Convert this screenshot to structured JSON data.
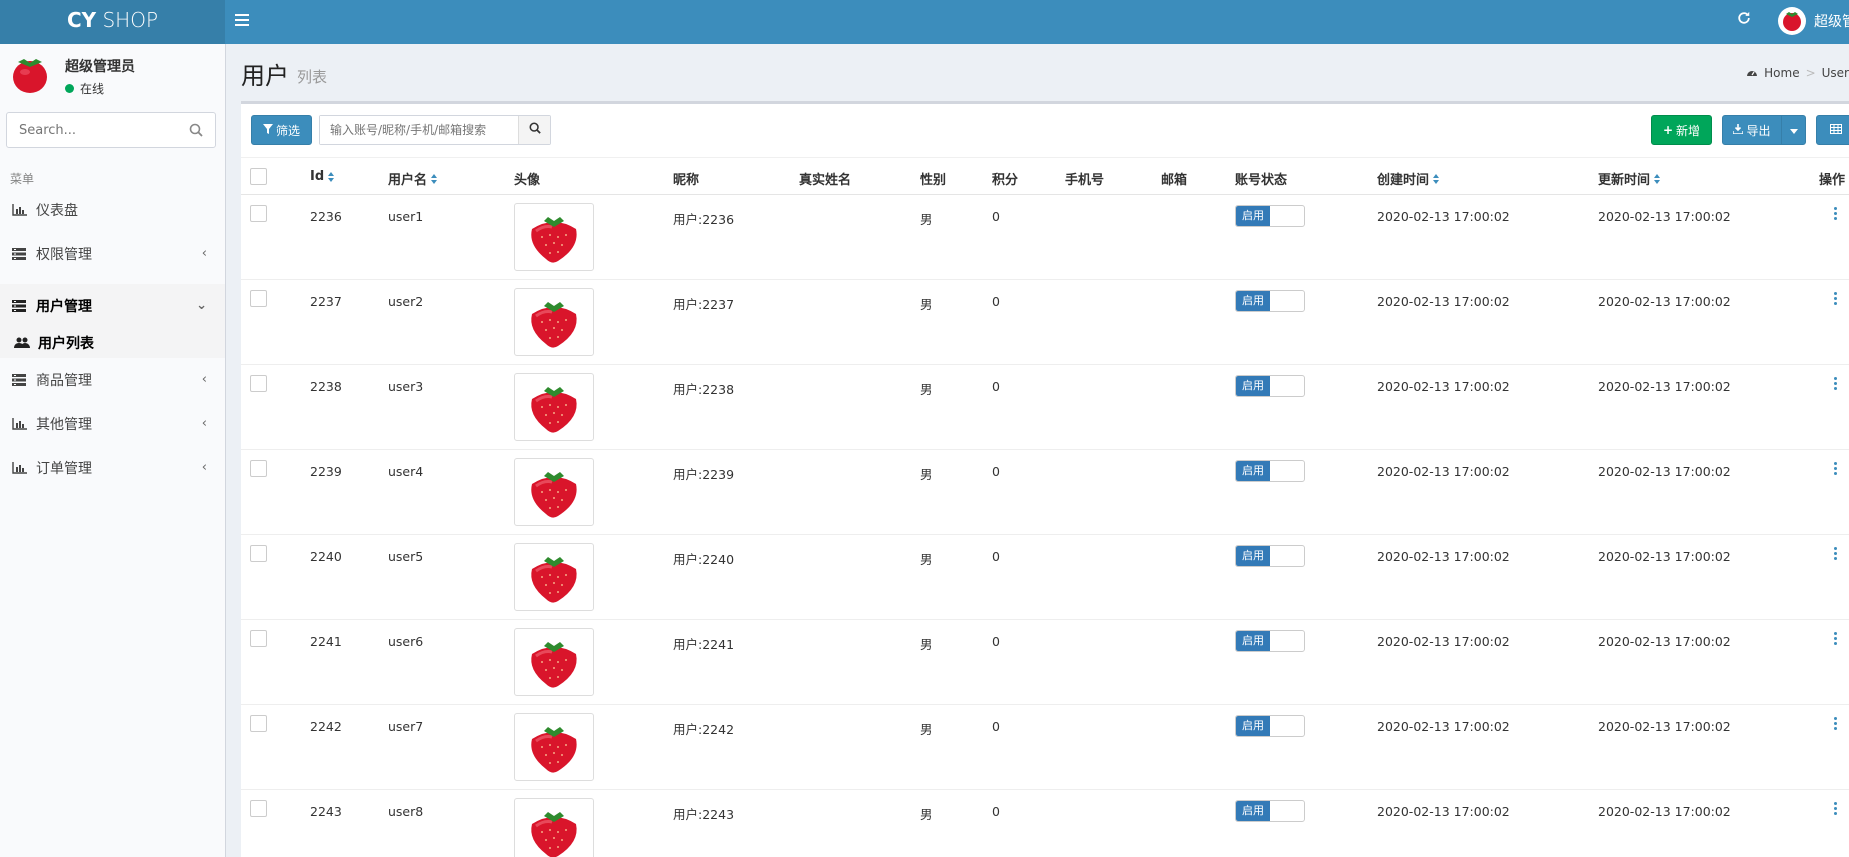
{
  "app": {
    "logo_bold": "CY",
    "logo_light": "SHOP",
    "top_user_name": "超级管"
  },
  "sidebar": {
    "user_name": "超级管理员",
    "status": "在线",
    "search_placeholder": "Search...",
    "menu_header": "菜单",
    "items": [
      {
        "label": "仪表盘",
        "icon": "bar-chart-icon"
      },
      {
        "label": "权限管理",
        "icon": "list-icon"
      },
      {
        "label": "用户管理",
        "icon": "list-icon"
      },
      {
        "label": "商品管理",
        "icon": "list-icon"
      },
      {
        "label": "其他管理",
        "icon": "bar-chart-icon"
      },
      {
        "label": "订单管理",
        "icon": "bar-chart-icon"
      }
    ],
    "submenu_label": "用户列表"
  },
  "header": {
    "title": "用户",
    "subtitle": "列表",
    "breadcrumb_home": "Home",
    "breadcrumb_current": "User"
  },
  "toolbar": {
    "filter_label": "筛选",
    "search_placeholder": "输入账号/昵称/手机/邮箱搜索",
    "add_label": "新增",
    "export_label": "导出"
  },
  "table": {
    "columns": [
      "Id",
      "用户名",
      "头像",
      "昵称",
      "真实姓名",
      "性别",
      "积分",
      "手机号",
      "邮箱",
      "账号状态",
      "创建时间",
      "更新时间",
      "操作"
    ],
    "rows": [
      {
        "id": "2236",
        "username": "user1",
        "nickname": "用户:2236",
        "realname": "",
        "gender": "男",
        "points": "0",
        "phone": "",
        "email": "",
        "status": "启用",
        "created": "2020-02-13 17:00:02",
        "updated": "2020-02-13 17:00:02"
      },
      {
        "id": "2237",
        "username": "user2",
        "nickname": "用户:2237",
        "realname": "",
        "gender": "男",
        "points": "0",
        "phone": "",
        "email": "",
        "status": "启用",
        "created": "2020-02-13 17:00:02",
        "updated": "2020-02-13 17:00:02"
      },
      {
        "id": "2238",
        "username": "user3",
        "nickname": "用户:2238",
        "realname": "",
        "gender": "男",
        "points": "0",
        "phone": "",
        "email": "",
        "status": "启用",
        "created": "2020-02-13 17:00:02",
        "updated": "2020-02-13 17:00:02"
      },
      {
        "id": "2239",
        "username": "user4",
        "nickname": "用户:2239",
        "realname": "",
        "gender": "男",
        "points": "0",
        "phone": "",
        "email": "",
        "status": "启用",
        "created": "2020-02-13 17:00:02",
        "updated": "2020-02-13 17:00:02"
      },
      {
        "id": "2240",
        "username": "user5",
        "nickname": "用户:2240",
        "realname": "",
        "gender": "男",
        "points": "0",
        "phone": "",
        "email": "",
        "status": "启用",
        "created": "2020-02-13 17:00:02",
        "updated": "2020-02-13 17:00:02"
      },
      {
        "id": "2241",
        "username": "user6",
        "nickname": "用户:2241",
        "realname": "",
        "gender": "男",
        "points": "0",
        "phone": "",
        "email": "",
        "status": "启用",
        "created": "2020-02-13 17:00:02",
        "updated": "2020-02-13 17:00:02"
      },
      {
        "id": "2242",
        "username": "user7",
        "nickname": "用户:2242",
        "realname": "",
        "gender": "男",
        "points": "0",
        "phone": "",
        "email": "",
        "status": "启用",
        "created": "2020-02-13 17:00:02",
        "updated": "2020-02-13 17:00:02"
      },
      {
        "id": "2243",
        "username": "user8",
        "nickname": "用户:2243",
        "realname": "",
        "gender": "男",
        "points": "0",
        "phone": "",
        "email": "",
        "status": "启用",
        "created": "2020-02-13 17:00:02",
        "updated": "2020-02-13 17:00:02"
      }
    ]
  },
  "colors": {
    "primary": "#3c8dbc",
    "success": "#00a65a",
    "switch_on": "#337ab7",
    "online": "#00a65a"
  }
}
